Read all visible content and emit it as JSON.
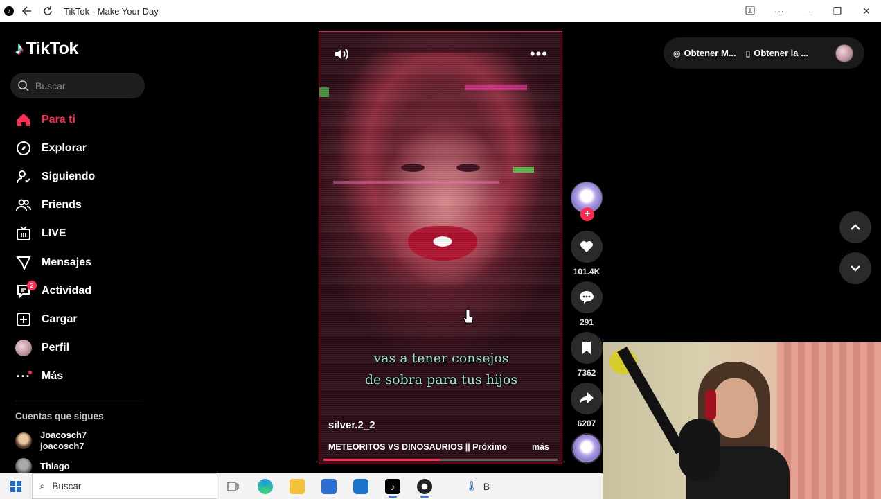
{
  "window": {
    "title": "TikTok - Make Your Day",
    "back_icon": "arrow-left-icon",
    "reload_icon": "reload-icon",
    "more_label": "···",
    "minimize_label": "—",
    "restore_label": "❐",
    "close_label": "✕"
  },
  "sidebar": {
    "logo_text": "TikTok",
    "search_placeholder": "Buscar",
    "items": [
      {
        "label": "Para ti",
        "icon": "home-icon",
        "active": true
      },
      {
        "label": "Explorar",
        "icon": "compass-icon"
      },
      {
        "label": "Siguiendo",
        "icon": "following-icon"
      },
      {
        "label": "Friends",
        "icon": "friends-icon"
      },
      {
        "label": "LIVE",
        "icon": "live-icon"
      },
      {
        "label": "Mensajes",
        "icon": "messages-icon"
      },
      {
        "label": "Actividad",
        "icon": "activity-icon",
        "badge": "2"
      },
      {
        "label": "Cargar",
        "icon": "upload-icon"
      },
      {
        "label": "Perfil",
        "icon": "profile-avatar"
      },
      {
        "label": "Más",
        "icon": "more-icon"
      }
    ],
    "following_title": "Cuentas que sigues",
    "following": [
      {
        "name": "Joacosch7",
        "handle": "joacosch7"
      },
      {
        "name": "Thiago",
        "handle": ""
      }
    ]
  },
  "video": {
    "caption_line1": "vas a tener consejos",
    "caption_line2": "de sobra para tus hijos",
    "username": "silver.2_2",
    "description": "METEORITOS VS DINOSAURIOS || Próximo",
    "more_link": "más",
    "progress": 0.5
  },
  "actions": {
    "likes": "101.4K",
    "comments": "291",
    "saves": "7362",
    "shares": "6207"
  },
  "top_bar": {
    "get_app_1": "Obtener M...",
    "get_app_2": "Obtener la ..."
  },
  "taskbar": {
    "search_label": "Buscar",
    "tray_text": "B"
  },
  "colors": {
    "accent": "#FE2C55",
    "background": "#000000"
  }
}
